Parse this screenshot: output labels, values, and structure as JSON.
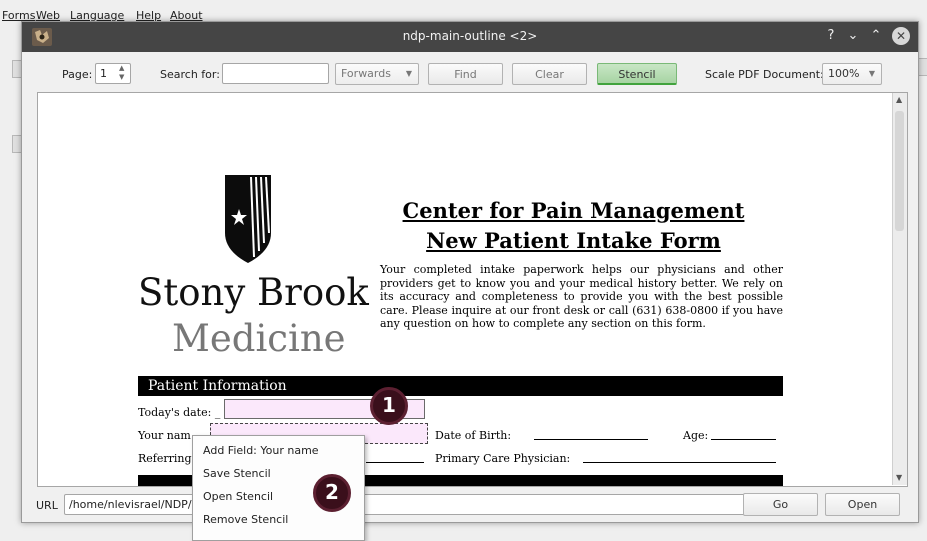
{
  "background_menu": [
    "Forms",
    "Web",
    "Language",
    "Help",
    "About"
  ],
  "window": {
    "title": "ndp-main-outline <2>",
    "help": "?",
    "minimize": "⌄",
    "maximize": "⌃",
    "close": "✕"
  },
  "toolbar": {
    "page_label": "Page:",
    "page_value": "1",
    "search_label": "Search for:",
    "search_value": "",
    "direction": "Forwards",
    "find": "Find",
    "clear": "Clear",
    "stencil": "Stencil",
    "scale_label": "Scale PDF Document:",
    "scale_value": "100%"
  },
  "document": {
    "logo_line1": "Stony Brook",
    "logo_line2": "Medicine",
    "heading1": "Center for Pain Management",
    "heading2": "New Patient Intake Form",
    "intro": "Your completed intake paperwork helps our physicians and other providers get to know you and your medical history better. We rely on its accuracy and completeness to provide you with the best possible care. Please inquire at our front desk or call (631) 638-0800 if you have any question on how to complete any section on this form.",
    "section": "Patient Information",
    "todays_date": "Today's date: _",
    "your_name": "Your nam",
    "dob": "Date of Birth:",
    "age": "Age:",
    "referring": "Referring",
    "pcp": "Primary Care Physician:"
  },
  "url_bar": {
    "label": "URL",
    "value": "/home/nlevisrael/NDP/c",
    "go": "Go",
    "open": "Open"
  },
  "context_menu": [
    "Add Field: Your name",
    "Save Stencil",
    "Open Stencil",
    "Remove Stencil"
  ],
  "badges": [
    "1",
    "2"
  ]
}
